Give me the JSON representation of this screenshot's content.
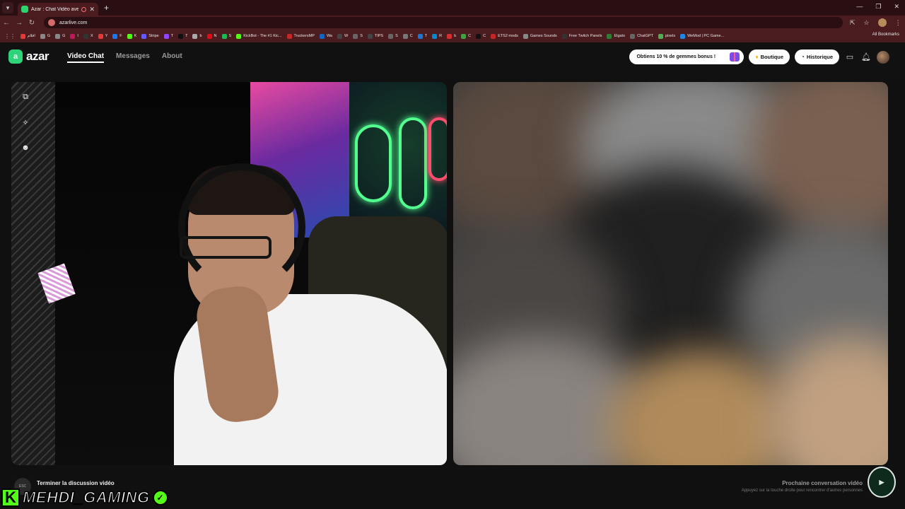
{
  "browser": {
    "tab_title": "Azar : Chat Vidéo avec de n",
    "url": "azarlive.com",
    "bookmarks": [
      {
        "label": "اقلام",
        "color": "#e53935"
      },
      {
        "label": "G",
        "color": "#888888"
      },
      {
        "label": "G",
        "color": "#888888"
      },
      {
        "label": "I",
        "color": "#c2185b"
      },
      {
        "label": "X",
        "color": "#333333"
      },
      {
        "label": "Y",
        "color": "#e53935"
      },
      {
        "label": "F",
        "color": "#1877f2"
      },
      {
        "label": "K",
        "color": "#53fc18"
      },
      {
        "label": "Stripe",
        "color": "#635bff"
      },
      {
        "label": "T",
        "color": "#9146ff"
      },
      {
        "label": "T",
        "color": "#111111"
      },
      {
        "label": "b",
        "color": "#aaaaaa"
      },
      {
        "label": "N",
        "color": "#e50914"
      },
      {
        "label": "S",
        "color": "#1db954"
      },
      {
        "label": "KickBot - The #1 Kic...",
        "color": "#53fc18"
      },
      {
        "label": "TruckersMP",
        "color": "#c62828"
      },
      {
        "label": "Wa",
        "color": "#1565c0"
      },
      {
        "label": "W",
        "color": "#444444"
      },
      {
        "label": "S",
        "color": "#666666"
      },
      {
        "label": "TIPS",
        "color": "#444444"
      },
      {
        "label": "S",
        "color": "#666666"
      },
      {
        "label": "C",
        "color": "#777777"
      },
      {
        "label": "T",
        "color": "#1976d2"
      },
      {
        "label": "R",
        "color": "#0288d1"
      },
      {
        "label": "b",
        "color": "#d32f2f"
      },
      {
        "label": "C",
        "color": "#43a047"
      },
      {
        "label": "C",
        "color": "#111111"
      },
      {
        "label": "ETS2 mods",
        "color": "#c62828"
      },
      {
        "label": "Games Sounds",
        "color": "#888888"
      },
      {
        "label": "Free Twitch Panels",
        "color": "#333333"
      },
      {
        "label": "Elgato",
        "color": "#2e7d32"
      },
      {
        "label": "ChatGPT",
        "color": "#666666"
      },
      {
        "label": "pixels",
        "color": "#4caf50"
      },
      {
        "label": "WeMod | PC Game...",
        "color": "#1e88e5"
      }
    ],
    "all_bookmarks": "All Bookmarks"
  },
  "header": {
    "logo_text": "azar",
    "nav": {
      "video_chat": "Video Chat",
      "messages": "Messages",
      "about": "About"
    },
    "promo": "Obtiens 10 % de gemmes bonus !",
    "boutique": "Boutique",
    "historique": "Historique"
  },
  "controls": {
    "end_call_label": "Terminer la discussion vidéo",
    "end_key": "ESC",
    "next_title": "Prochaine conversation vidéo",
    "next_sub": "Appuyez sur la touche droite pour rencontrer d'autres personnes"
  },
  "overlay": {
    "kick_letter": "K",
    "streamer_name": "MEHDI_GAMING",
    "badge_color": "#53fc18"
  },
  "colors": {
    "brand": "#2ed47a",
    "tab_bar": "#2a0f12",
    "chrome": "#4a1c20",
    "neon_green": "#52ff8f"
  }
}
